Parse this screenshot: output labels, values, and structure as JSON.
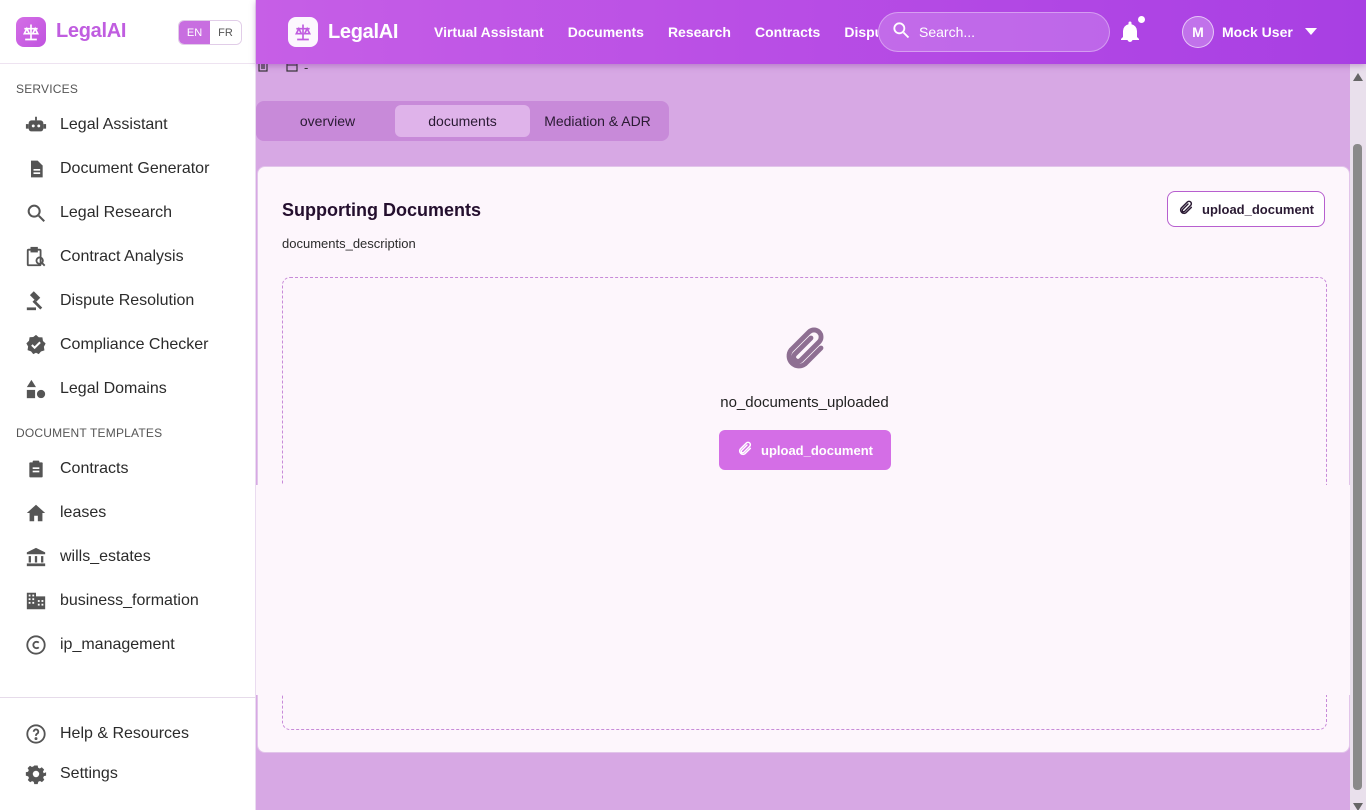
{
  "brand": {
    "name": "LegalAI"
  },
  "lang": {
    "en": "EN",
    "fr": "FR"
  },
  "sidebar": {
    "services_title": "SERVICES",
    "services": [
      {
        "label": "Legal Assistant",
        "icon": "robot-icon"
      },
      {
        "label": "Document Generator",
        "icon": "document-icon"
      },
      {
        "label": "Legal Research",
        "icon": "search-icon"
      },
      {
        "label": "Contract Analysis",
        "icon": "contract-search-icon"
      },
      {
        "label": "Dispute Resolution",
        "icon": "gavel-icon"
      },
      {
        "label": "Compliance Checker",
        "icon": "verified-icon"
      },
      {
        "label": "Legal Domains",
        "icon": "category-icon"
      }
    ],
    "templates_title": "DOCUMENT TEMPLATES",
    "templates": [
      {
        "label": "Contracts",
        "icon": "clipboard-icon"
      },
      {
        "label": "leases",
        "icon": "home-icon"
      },
      {
        "label": "wills_estates",
        "icon": "bank-icon"
      },
      {
        "label": "business_formation",
        "icon": "building-icon"
      },
      {
        "label": "ip_management",
        "icon": "copyright-icon"
      }
    ],
    "footer": [
      {
        "label": "Help & Resources",
        "icon": "help-icon"
      },
      {
        "label": "Settings",
        "icon": "gear-icon"
      }
    ]
  },
  "topbar": {
    "nav": [
      "Virtual Assistant",
      "Documents",
      "Research",
      "Contracts",
      "Disputes"
    ],
    "search_placeholder": "Search...",
    "user_initial": "M",
    "user_name": "Mock User"
  },
  "breadcrumb": {
    "trail": "-"
  },
  "tabs": [
    "overview",
    "documents",
    "Mediation & ADR"
  ],
  "card": {
    "title": "Supporting Documents",
    "description": "documents_description",
    "upload_label": "upload_document",
    "empty_text": "no_documents_uploaded",
    "empty_upload_label": "upload_document"
  },
  "colors": {
    "accent": "#c65fe6",
    "page_bg": "#d7a8e4",
    "card_bg": "#fdf6fc"
  }
}
